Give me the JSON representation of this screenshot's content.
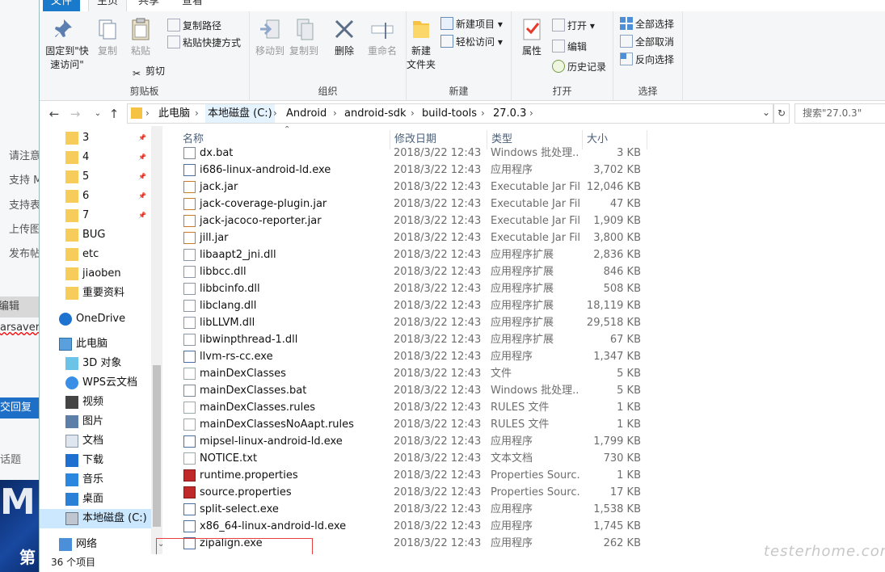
{
  "background_page": {
    "texts": [
      "请注意",
      "支持 M",
      "支持表",
      "上传图",
      "发布帖"
    ],
    "edit_tab": "编辑",
    "link_text": "arsaver",
    "reply_button": "交回复",
    "topic_label": "话题",
    "banner_letter": "M",
    "banner_text": "第"
  },
  "ribbon_tabs": [
    "文件",
    "主页",
    "共享",
    "查看"
  ],
  "ribbon": {
    "clipboard": {
      "label": "剪贴板",
      "pin": "固定到\"快\n速访问\"",
      "copy": "复制",
      "paste": "粘贴",
      "copy_path": "复制路径",
      "paste_shortcut": "粘贴快捷方式",
      "cut": "剪切"
    },
    "organize": {
      "label": "组织",
      "move_to": "移动到",
      "copy_to": "复制到",
      "delete": "删除",
      "rename": "重命名"
    },
    "new": {
      "label": "新建",
      "new_folder": "新建\n文件夹",
      "new_item": "新建项目",
      "easy_access": "轻松访问"
    },
    "open": {
      "label": "打开",
      "properties": "属性",
      "open": "打开",
      "edit": "编辑",
      "history": "历史记录"
    },
    "select": {
      "label": "选择",
      "select_all": "全部选择",
      "select_none": "全部取消",
      "invert": "反向选择"
    }
  },
  "address_bar": {
    "crumbs": [
      "此电脑",
      "本地磁盘 (C:)",
      "Android",
      "android-sdk",
      "build-tools",
      "27.0.3"
    ],
    "search_placeholder": "搜索\"27.0.3\""
  },
  "nav_pane": {
    "quick_items": [
      "3",
      "4",
      "5",
      "6",
      "7",
      "BUG",
      "etc",
      "jiaoben",
      "重要资料"
    ],
    "onedrive": "OneDrive",
    "this_pc": "此电脑",
    "pc_items": [
      "3D 对象",
      "WPS云文档",
      "视频",
      "图片",
      "文档",
      "下载",
      "音乐",
      "桌面",
      "本地磁盘 (C:)"
    ],
    "network": "网络"
  },
  "columns": {
    "name": "名称",
    "date": "修改日期",
    "type": "类型",
    "size": "大小"
  },
  "files": [
    {
      "name": "dx.bat",
      "date": "2018/3/22 12:43",
      "type": "Windows 批处理...",
      "size": "3 KB",
      "icon": "bat"
    },
    {
      "name": "i686-linux-android-ld.exe",
      "date": "2018/3/22 12:43",
      "type": "应用程序",
      "size": "3,702 KB",
      "icon": "exe"
    },
    {
      "name": "jack.jar",
      "date": "2018/3/22 12:43",
      "type": "Executable Jar File",
      "size": "12,046 KB",
      "icon": "jar"
    },
    {
      "name": "jack-coverage-plugin.jar",
      "date": "2018/3/22 12:43",
      "type": "Executable Jar File",
      "size": "47 KB",
      "icon": "jar"
    },
    {
      "name": "jack-jacoco-reporter.jar",
      "date": "2018/3/22 12:43",
      "type": "Executable Jar File",
      "size": "1,909 KB",
      "icon": "jar"
    },
    {
      "name": "jill.jar",
      "date": "2018/3/22 12:43",
      "type": "Executable Jar File",
      "size": "3,800 KB",
      "icon": "jar"
    },
    {
      "name": "libaapt2_jni.dll",
      "date": "2018/3/22 12:43",
      "type": "应用程序扩展",
      "size": "2,836 KB",
      "icon": "dll"
    },
    {
      "name": "libbcc.dll",
      "date": "2018/3/22 12:43",
      "type": "应用程序扩展",
      "size": "846 KB",
      "icon": "dll"
    },
    {
      "name": "libbcinfo.dll",
      "date": "2018/3/22 12:43",
      "type": "应用程序扩展",
      "size": "508 KB",
      "icon": "dll"
    },
    {
      "name": "libclang.dll",
      "date": "2018/3/22 12:43",
      "type": "应用程序扩展",
      "size": "18,119 KB",
      "icon": "dll"
    },
    {
      "name": "libLLVM.dll",
      "date": "2018/3/22 12:43",
      "type": "应用程序扩展",
      "size": "29,518 KB",
      "icon": "dll"
    },
    {
      "name": "libwinpthread-1.dll",
      "date": "2018/3/22 12:43",
      "type": "应用程序扩展",
      "size": "67 KB",
      "icon": "dll"
    },
    {
      "name": "llvm-rs-cc.exe",
      "date": "2018/3/22 12:43",
      "type": "应用程序",
      "size": "1,347 KB",
      "icon": "exe"
    },
    {
      "name": "mainDexClasses",
      "date": "2018/3/22 12:43",
      "type": "文件",
      "size": "5 KB",
      "icon": "file"
    },
    {
      "name": "mainDexClasses.bat",
      "date": "2018/3/22 12:43",
      "type": "Windows 批处理...",
      "size": "5 KB",
      "icon": "bat"
    },
    {
      "name": "mainDexClasses.rules",
      "date": "2018/3/22 12:43",
      "type": "RULES 文件",
      "size": "1 KB",
      "icon": "file"
    },
    {
      "name": "mainDexClassesNoAapt.rules",
      "date": "2018/3/22 12:43",
      "type": "RULES 文件",
      "size": "1 KB",
      "icon": "file"
    },
    {
      "name": "mipsel-linux-android-ld.exe",
      "date": "2018/3/22 12:43",
      "type": "应用程序",
      "size": "1,799 KB",
      "icon": "exe"
    },
    {
      "name": "NOTICE.txt",
      "date": "2018/3/22 12:43",
      "type": "文本文档",
      "size": "730 KB",
      "icon": "txt"
    },
    {
      "name": "runtime.properties",
      "date": "2018/3/22 12:43",
      "type": "Properties Sourc...",
      "size": "1 KB",
      "icon": "prop"
    },
    {
      "name": "source.properties",
      "date": "2018/3/22 12:43",
      "type": "Properties Sourc...",
      "size": "17 KB",
      "icon": "prop"
    },
    {
      "name": "split-select.exe",
      "date": "2018/3/22 12:43",
      "type": "应用程序",
      "size": "1,538 KB",
      "icon": "exe"
    },
    {
      "name": "x86_64-linux-android-ld.exe",
      "date": "2018/3/22 12:43",
      "type": "应用程序",
      "size": "1,745 KB",
      "icon": "exe"
    },
    {
      "name": "zipalign.exe",
      "date": "2018/3/22 12:43",
      "type": "应用程序",
      "size": "262 KB",
      "icon": "exe"
    }
  ],
  "status_bar": {
    "count": "36 个项目"
  },
  "watermark": "testerhome.com",
  "colors": {
    "accent": "#1979ca",
    "selection": "#cce8ff",
    "annotation_box": "#e64040"
  }
}
